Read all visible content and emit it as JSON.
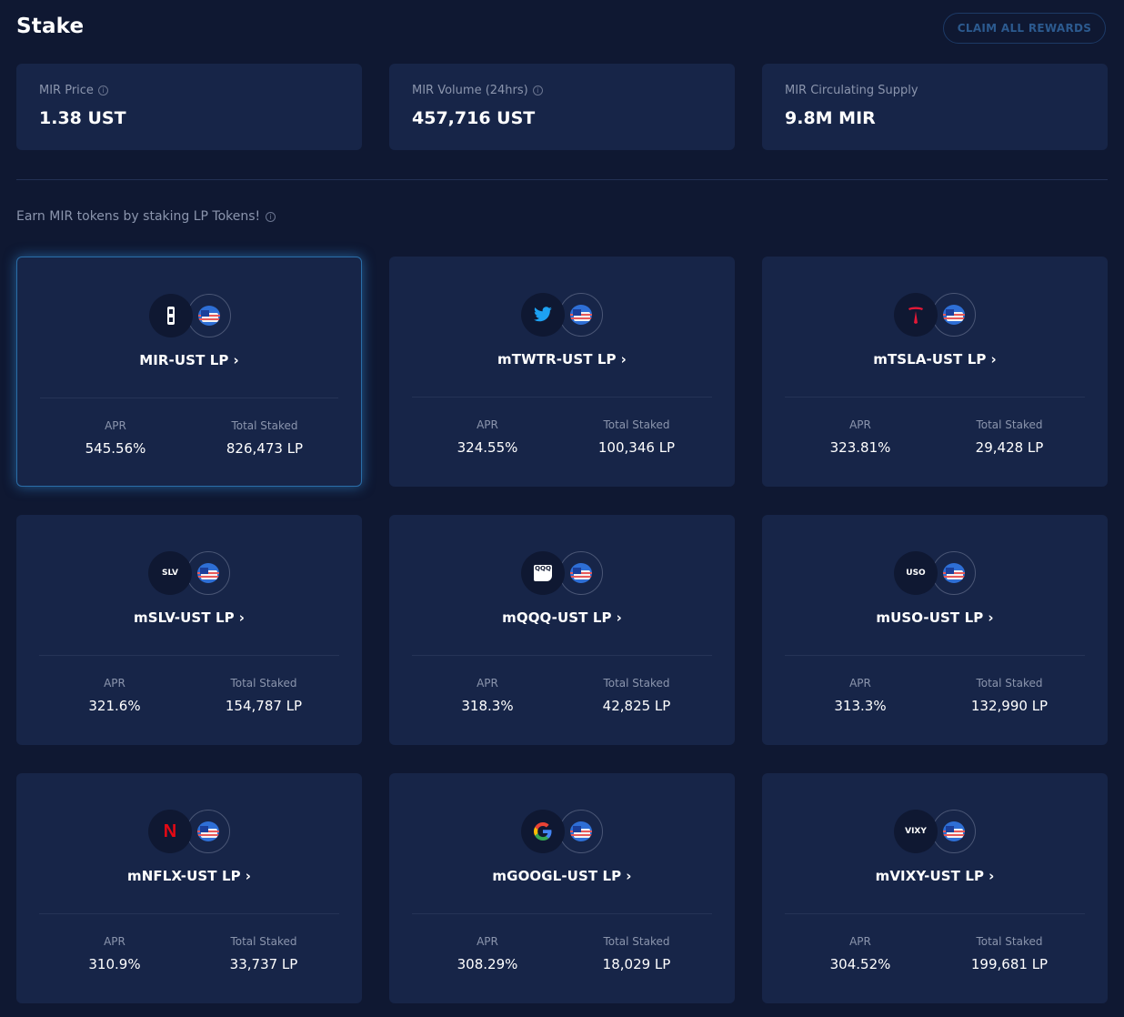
{
  "header": {
    "title": "Stake",
    "claim_label": "CLAIM ALL REWARDS"
  },
  "stats": [
    {
      "label": "MIR Price",
      "value": "1.38 UST",
      "info": true
    },
    {
      "label": "MIR Volume (24hrs)",
      "value": "457,716 UST",
      "info": true
    },
    {
      "label": "MIR Circulating Supply",
      "value": "9.8M MIR",
      "info": false
    }
  ],
  "subtitle": "Earn MIR tokens by staking LP Tokens!",
  "apr_label": "APR",
  "total_staked_label": "Total Staked",
  "pools": [
    {
      "name": "MIR-UST LP",
      "apr": "545.56%",
      "staked": "826,473 LP",
      "icon": "mirror-icon"
    },
    {
      "name": "mTWTR-UST LP",
      "apr": "324.55%",
      "staked": "100,346 LP",
      "icon": "twitter-icon"
    },
    {
      "name": "mTSLA-UST LP",
      "apr": "323.81%",
      "staked": "29,428 LP",
      "icon": "tesla-icon"
    },
    {
      "name": "mSLV-UST LP",
      "apr": "321.6%",
      "staked": "154,787 LP",
      "icon": "slv-icon",
      "icon_text": "SLV"
    },
    {
      "name": "mQQQ-UST LP",
      "apr": "318.3%",
      "staked": "42,825 LP",
      "icon": "qqq-icon",
      "icon_text": "QQQ"
    },
    {
      "name": "mUSO-UST LP",
      "apr": "313.3%",
      "staked": "132,990 LP",
      "icon": "uso-icon",
      "icon_text": "USO"
    },
    {
      "name": "mNFLX-UST LP",
      "apr": "310.9%",
      "staked": "33,737 LP",
      "icon": "netflix-icon",
      "icon_text": "N"
    },
    {
      "name": "mGOOGL-UST LP",
      "apr": "308.29%",
      "staked": "18,029 LP",
      "icon": "google-icon",
      "icon_text": "G"
    },
    {
      "name": "mVIXY-UST LP",
      "apr": "304.52%",
      "staked": "199,681 LP",
      "icon": "vixy-icon",
      "icon_text": "VIXY"
    }
  ],
  "colors": {
    "background": "#0f1832",
    "card": "#172548",
    "accent_border": "#2a6ea8",
    "tesla_red": "#e31937",
    "twitter_blue": "#1da1f2",
    "netflix_red": "#e50914"
  }
}
